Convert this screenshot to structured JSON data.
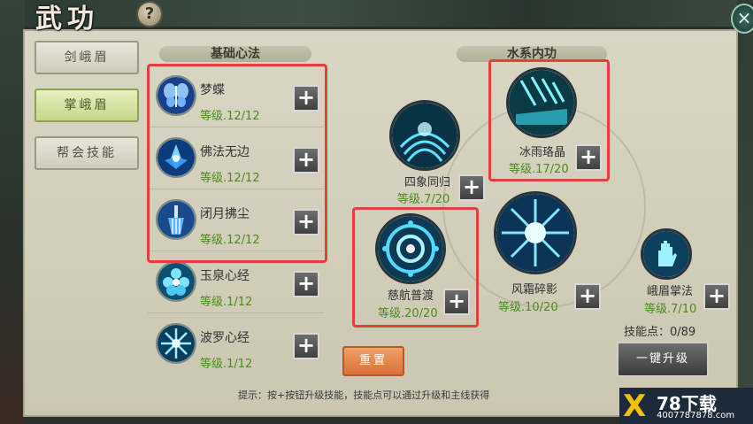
{
  "window": {
    "title": "武功",
    "help_label": "?",
    "close_label": "×"
  },
  "tabs": [
    {
      "label": "剑峨眉",
      "active": false
    },
    {
      "label": "掌峨眉",
      "active": true
    },
    {
      "label": "帮会技能",
      "active": false
    }
  ],
  "basic": {
    "title": "基础心法",
    "skills": [
      {
        "name": "梦蝶",
        "level": "等级.12/12",
        "icon": "butterfly-icon"
      },
      {
        "name": "佛法无边",
        "level": "等级.12/12",
        "icon": "lotus-icon"
      },
      {
        "name": "闭月拂尘",
        "level": "等级.12/12",
        "icon": "whisk-icon"
      },
      {
        "name": "玉泉心经",
        "level": "等级.1/12",
        "icon": "jade-flower-icon"
      },
      {
        "name": "波罗心经",
        "level": "等级.1/12",
        "icon": "snowflake-icon"
      }
    ]
  },
  "water": {
    "title": "水系内功",
    "skills": [
      {
        "name": "四象同归",
        "level": "等级.7/20",
        "icon": "wave-icon"
      },
      {
        "name": "冰雨珞晶",
        "level": "等级.17/20",
        "icon": "ice-rain-icon"
      },
      {
        "name": "慈航普渡",
        "level": "等级.20/20",
        "icon": "mandala-icon"
      },
      {
        "name": "风霜碎影",
        "level": "等级.10/20",
        "icon": "frost-burst-icon"
      },
      {
        "name": "峨眉掌法",
        "level": "等级.7/10",
        "icon": "palm-icon"
      }
    ]
  },
  "plus_label": "+",
  "reset_label": "重置",
  "skill_points": "技能点：0/89",
  "upgrade_all_label": "一键升级",
  "tip": "提示：按+按钮升级技能，技能点可以通过升级和主线获得",
  "watermark": {
    "logo": "X",
    "title": "78下载",
    "url": "4007787878.com"
  },
  "colors": {
    "level_green": "#4d8a1e",
    "highlight_red": "#e0413c",
    "active_tab": "#c6d68a",
    "reset_orange": "#d77236"
  }
}
